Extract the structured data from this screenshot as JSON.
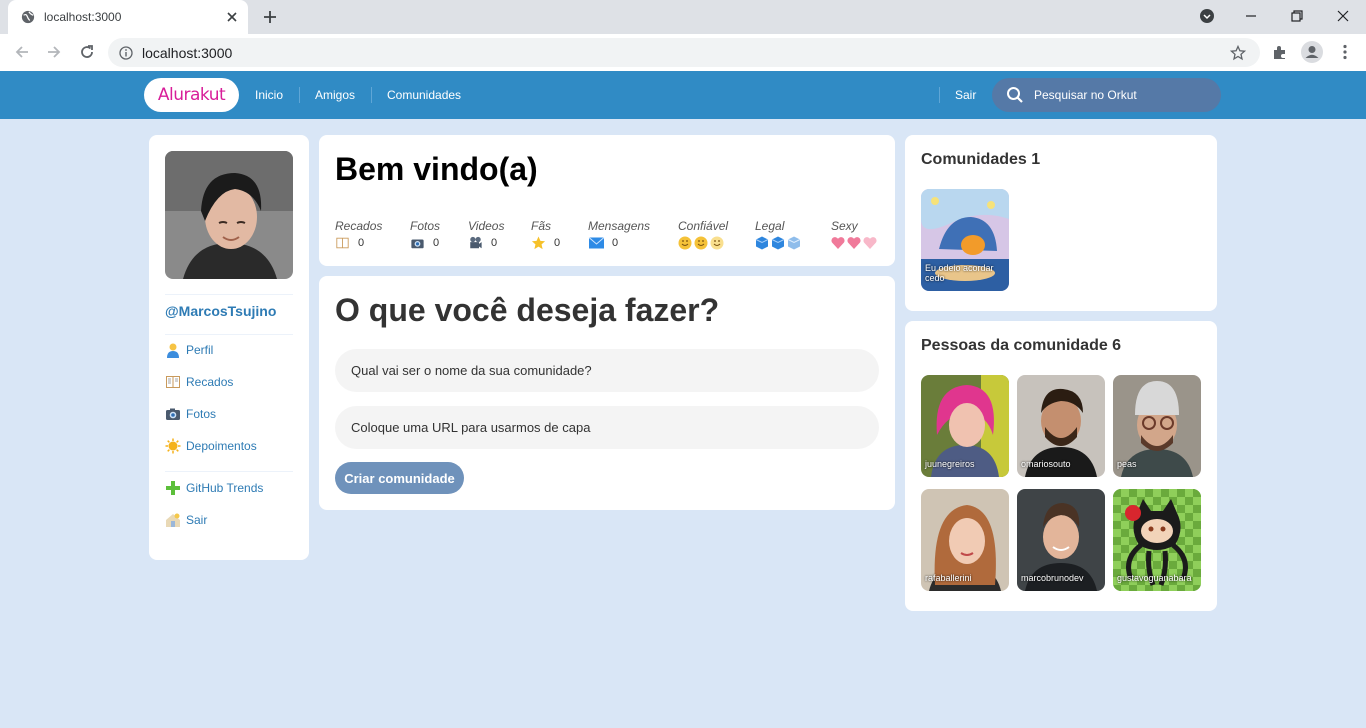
{
  "browser": {
    "tab_title": "localhost:3000",
    "url": "localhost:3000"
  },
  "header": {
    "logo": "Alurakut",
    "nav": [
      "Inicio",
      "Amigos",
      "Comunidades"
    ],
    "logout": "Sair",
    "search_placeholder": "Pesquisar no Orkut",
    "colors": {
      "bar": "#308bc5",
      "logo": "#d81d99"
    }
  },
  "sidebar": {
    "username": "@MarcosTsujino",
    "items": [
      {
        "label": "Perfil",
        "icon": "user-icon"
      },
      {
        "label": "Recados",
        "icon": "book-icon"
      },
      {
        "label": "Fotos",
        "icon": "camera-icon"
      },
      {
        "label": "Depoimentos",
        "icon": "sun-icon"
      }
    ],
    "items2": [
      {
        "label": "GitHub Trends",
        "icon": "plus-icon"
      },
      {
        "label": "Sair",
        "icon": "logout-icon"
      }
    ]
  },
  "welcome": {
    "title": "Bem vindo(a)",
    "stats": [
      {
        "label": "Recados",
        "value": "0",
        "icon": "book-icon"
      },
      {
        "label": "Fotos",
        "value": "0",
        "icon": "camera-icon"
      },
      {
        "label": "Videos",
        "value": "0",
        "icon": "video-camera-icon"
      },
      {
        "label": "Fãs",
        "value": "0",
        "icon": "star-icon"
      },
      {
        "label": "Mensagens",
        "value": "0",
        "icon": "envelope-icon"
      },
      {
        "label": "Confiável",
        "value": "",
        "icon": "smiley-icon"
      },
      {
        "label": "Legal",
        "value": "",
        "icon": "cube-icon"
      },
      {
        "label": "Sexy",
        "value": "",
        "icon": "heart-icon"
      }
    ]
  },
  "form": {
    "title": "O que você deseja fazer?",
    "name_placeholder": "Qual vai ser o nome da sua comunidade?",
    "url_placeholder": "Coloque uma URL para usarmos de capa",
    "button": "Criar comunidade"
  },
  "communities": {
    "title": "Comunidades 1",
    "items": [
      "Eu odeio acordar cedo"
    ]
  },
  "people": {
    "title": "Pessoas da comunidade 6",
    "items": [
      "juunegreiros",
      "omariosouto",
      "peas",
      "rafaballerini",
      "marcobrunodev",
      "gustavoguanabara"
    ]
  }
}
